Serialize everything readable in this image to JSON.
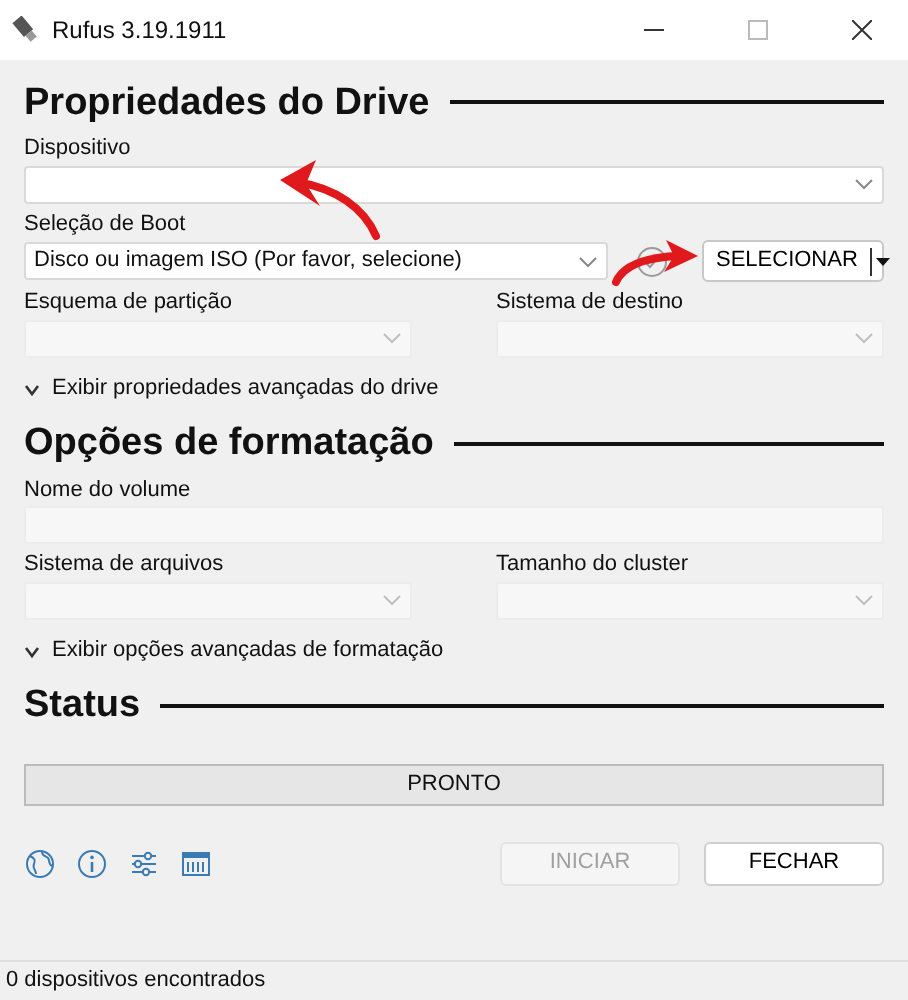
{
  "window": {
    "title": "Rufus 3.19.1911"
  },
  "sections": [
    {
      "title": "Propriedades do Drive",
      "rows": [
        [
          {
            "kind": "select",
            "label": "Dispositivo",
            "disabled": false
          }
        ],
        [
          {
            "kind": "boot",
            "label": "Seleção de Boot",
            "value": "Disco ou imagem ISO (Por favor, selecione)",
            "disabled": false,
            "button": "SELECIONAR"
          }
        ],
        [
          {
            "kind": "select",
            "label": "Esquema de partição",
            "disabled": true
          },
          {
            "kind": "select",
            "label": "Sistema de destino",
            "disabled": true
          }
        ]
      ],
      "toggle": {
        "label": "Exibir propriedades avançadas do drive",
        "expanded": false
      }
    },
    {
      "title": "Opções de formatação",
      "rows": [
        [
          {
            "kind": "text",
            "label": "Nome do volume",
            "disabled": true
          }
        ],
        [
          {
            "kind": "select",
            "label": "Sistema de arquivos",
            "disabled": true
          },
          {
            "kind": "select",
            "label": "Tamanho do cluster",
            "disabled": true
          }
        ]
      ],
      "toggle": {
        "label": "Exibir opções avançadas de formatação",
        "expanded": false
      }
    },
    {
      "title": "Status",
      "progress": {
        "text": "PRONTO",
        "level": 0
      }
    }
  ],
  "buttons": [
    {
      "label": "INICIAR",
      "disabled": true
    },
    {
      "label": "FECHAR",
      "disabled": false
    }
  ],
  "status_bar": "0 dispositivos encontrados"
}
